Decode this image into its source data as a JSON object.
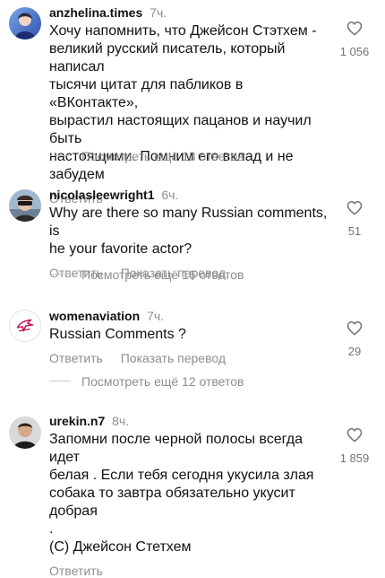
{
  "comments": [
    {
      "username": "anzhelina.times",
      "time": "7ч.",
      "text": "Хочу напомнить, что Джейсон Стэтхем -\nвеликий русский писатель, который написал\nтысячи цитат для пабликов в «ВКонтакте»,\nвырастил настоящих пацанов и научил быть\nнастоящими. Помним его вклад и не\nзабудем",
      "likes": "1 056",
      "reply_label": "Ответить",
      "more_replies": "Посмотреть ещё 13 ответов"
    },
    {
      "username": "nicolasleewright1",
      "time": "6ч.",
      "text": "Why are there so many Russian comments, is\nhe your favorite actor?",
      "likes": "51",
      "reply_label": "Ответить",
      "translate_label": "Показать перевод",
      "more_replies": "Посмотреть ещё 16 ответов"
    },
    {
      "username": "womenaviation",
      "time": "7ч.",
      "text": "Russian Comments ?",
      "likes": "29",
      "reply_label": "Ответить",
      "translate_label": "Показать перевод",
      "more_replies": "Посмотреть ещё 12 ответов"
    },
    {
      "username": "urekin.n7",
      "time": "8ч.",
      "text": "Запомни после черной полосы всегда идет\nбелая .  Если тебя сегодня укусила злая\nсобака то завтра обязательно укусит добрая\n.\n(С) Джейсон Стетхем",
      "likes": "1 859",
      "reply_label": "Ответить"
    }
  ],
  "colors": {
    "text": "#111111",
    "secondary": "#8e8e8e",
    "divider": "#c7c7c7"
  },
  "icons": {
    "like": "heart-outline-icon",
    "avatar_3": "aviation-logo-icon"
  }
}
